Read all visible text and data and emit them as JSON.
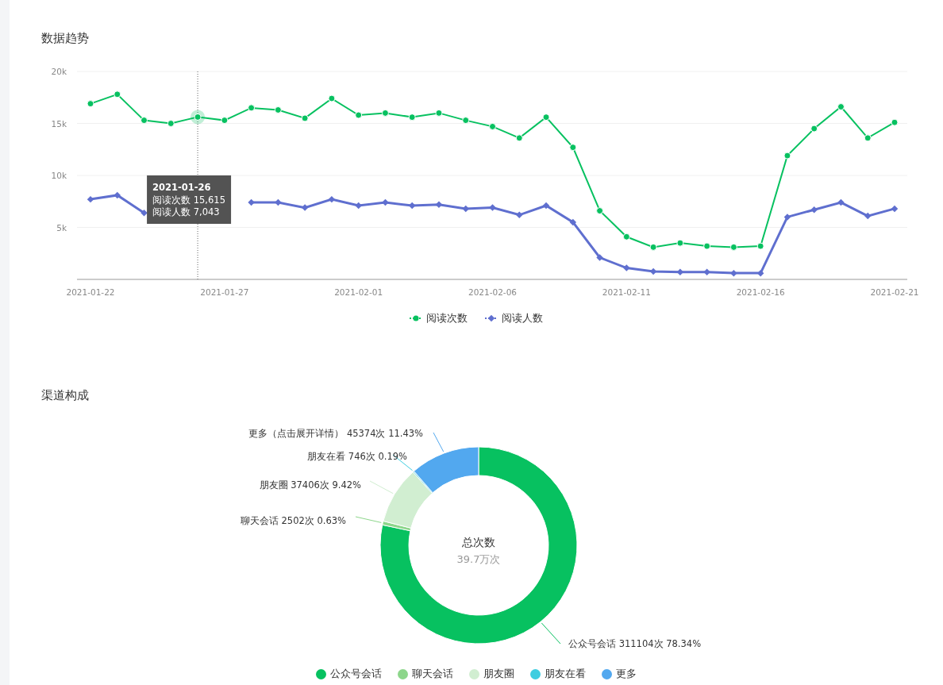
{
  "trend": {
    "title": "数据趋势",
    "chart_data": {
      "type": "line",
      "grid": true,
      "categories": [
        "2021-01-22",
        null,
        null,
        null,
        null,
        "2021-01-27",
        null,
        null,
        null,
        null,
        "2021-02-01",
        null,
        null,
        null,
        null,
        "2021-02-06",
        null,
        null,
        null,
        null,
        "2021-02-11",
        null,
        null,
        null,
        null,
        "2021-02-16",
        null,
        null,
        null,
        null,
        "2021-02-21"
      ],
      "series": [
        {
          "name": "阅读次数",
          "color": "#07c160",
          "marker": "circle",
          "values": [
            16900,
            17800,
            15300,
            15000,
            15615,
            15300,
            16500,
            16300,
            15500,
            17400,
            15800,
            16000,
            15600,
            16000,
            15300,
            14700,
            13600,
            15600,
            12700,
            6600,
            4100,
            3100,
            3500,
            3200,
            3100,
            3200,
            11900,
            14500,
            16600,
            13600,
            15100
          ]
        },
        {
          "name": "阅读人数",
          "color": "#5f6fcf",
          "marker": "diamond",
          "values": [
            7700,
            8100,
            6400,
            null,
            null,
            null,
            7400,
            7400,
            6900,
            7700,
            7100,
            7400,
            7100,
            7200,
            6800,
            6900,
            6200,
            7100,
            5500,
            2100,
            1100,
            760,
            700,
            700,
            600,
            600,
            6000,
            6700,
            7400,
            6100,
            6800
          ]
        }
      ],
      "ylim": [
        0,
        20000
      ],
      "yticks": [
        {
          "value": 5000,
          "label": "5k"
        },
        {
          "value": 10000,
          "label": "10k"
        },
        {
          "value": 15000,
          "label": "15k"
        },
        {
          "value": 20000,
          "label": "20k"
        }
      ]
    },
    "tooltip": {
      "title": "2021-01-26",
      "rows": [
        "阅读次数 15,615",
        "阅读人数 7,043"
      ]
    }
  },
  "channels": {
    "title": "渠道构成",
    "center_title": "总次数",
    "center_value": "39.7万次",
    "chart_data": {
      "type": "donut",
      "categories": [
        "公众号会话",
        "聊天会话",
        "朋友圈",
        "朋友在看",
        "更多"
      ],
      "series": [
        {
          "values": [
            78.34,
            0.63,
            9.42,
            0.19,
            11.43
          ]
        }
      ],
      "colors": [
        "#07c160",
        "#8dd68b",
        "#d1eed1",
        "#3ecde0",
        "#52a8ef"
      ],
      "value_labels": [
        "公众号会话 311104次 78.34%",
        "聊天会话 2502次 0.63%",
        "朋友圈 37406次 9.42%",
        "朋友在看 746次 0.19%",
        "更多（点击展开详情） 45374次 11.43%"
      ]
    }
  }
}
